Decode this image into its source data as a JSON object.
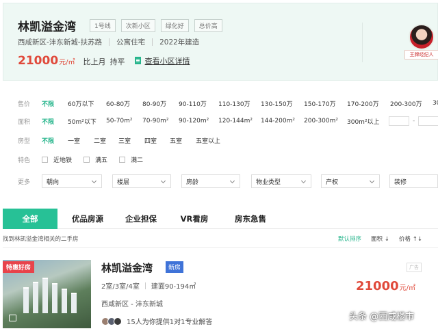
{
  "header": {
    "title": "林凯溢金湾",
    "tags": [
      "1号线",
      "次新小区",
      "绿化好",
      "总价高"
    ],
    "district": "西咸新区-沣东新城-扶苏路",
    "type": "公寓住宅",
    "year": "2022年建造",
    "price": "21000",
    "price_unit": "元/㎡",
    "compare_label": "比上月",
    "compare_value": "持平",
    "detail_link": "查看小区详情",
    "agent_label": "王牌经纪人"
  },
  "filters": {
    "price": {
      "label": "售价",
      "options": [
        "不限",
        "60万以下",
        "60-80万",
        "80-90万",
        "90-110万",
        "110-130万",
        "130-150万",
        "150-170万",
        "170-200万",
        "200-300万",
        "30"
      ]
    },
    "area": {
      "label": "面积",
      "options": [
        "不限",
        "50m²以下",
        "50-70m²",
        "70-90m²",
        "90-120m²",
        "120-144m²",
        "144-200m²",
        "200-300m²",
        "300m²以上"
      ],
      "range_dash": "-"
    },
    "rooms": {
      "label": "房型",
      "options": [
        "不限",
        "一室",
        "二室",
        "三室",
        "四室",
        "五室",
        "五室以上"
      ]
    },
    "features": {
      "label": "特色",
      "options": [
        "近地铁",
        "满五",
        "满二"
      ]
    },
    "more": {
      "label": "更多",
      "selects": [
        "朝向",
        "楼层",
        "房龄",
        "物业类型",
        "产权",
        "装修"
      ]
    }
  },
  "tabs": [
    "全部",
    "优品房源",
    "企业担保",
    "VR看房",
    "房东急售"
  ],
  "subbar": {
    "found": "找到林凯溢金湾相关的二手房",
    "sorts": [
      "默认排序",
      "面积 ↓",
      "价格 ↑↓"
    ]
  },
  "listing": {
    "badge": "特惠好房",
    "title": "林凯溢金湾",
    "new_badge": "新房",
    "ad": "广告",
    "rooms": "2室/3室/4室",
    "area": "建面90-194㎡",
    "location": "西咸新区 - 沣东新城",
    "price": "21000",
    "price_unit": "元/㎡",
    "agents_text": "15人为你提供1对1专业解答"
  },
  "watermark": "头条 @西咸楼市",
  "colors": {
    "accent": "#27c196",
    "price": "#e0493a",
    "new_badge": "#3f73d8",
    "hot_badge": "#e8434b"
  }
}
